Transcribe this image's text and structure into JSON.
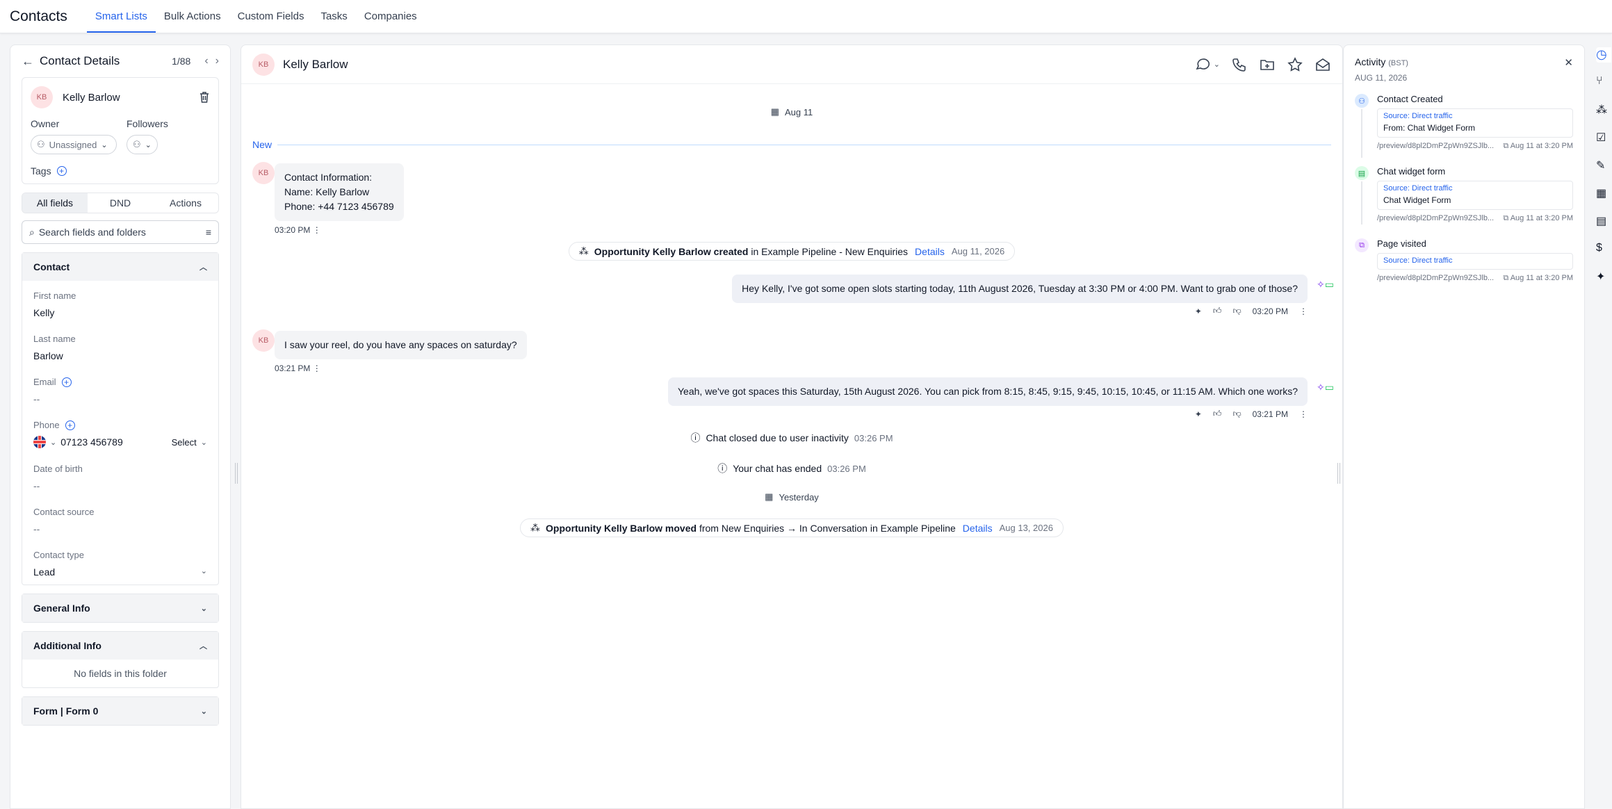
{
  "topnav": {
    "title": "Contacts",
    "tabs": [
      "Smart Lists",
      "Bulk Actions",
      "Custom Fields",
      "Tasks",
      "Companies"
    ],
    "active_tab": "Smart Lists"
  },
  "left": {
    "title": "Contact Details",
    "counter": "1/88",
    "contact_initials": "KB",
    "contact_name": "Kelly Barlow",
    "owner_label": "Owner",
    "owner_value": "Unassigned",
    "followers_label": "Followers",
    "tags_label": "Tags",
    "tabs": [
      "All fields",
      "DND",
      "Actions"
    ],
    "search_placeholder": "Search fields and folders",
    "contact_section": "Contact",
    "fields": {
      "first_name_label": "First name",
      "first_name": "Kelly",
      "last_name_label": "Last name",
      "last_name": "Barlow",
      "email_label": "Email",
      "email": "--",
      "phone_label": "Phone",
      "phone": "07123 456789",
      "phone_type": "Select",
      "dob_label": "Date of birth",
      "dob": "--",
      "source_label": "Contact source",
      "source": "--",
      "type_label": "Contact type",
      "type": "Lead"
    },
    "general_info": "General Info",
    "additional_info": "Additional Info",
    "no_fields": "No fields in this folder",
    "form_section": "Form | Form 0"
  },
  "center": {
    "initials": "KB",
    "name": "Kelly Barlow",
    "date_chip_1": "Aug 11",
    "new_label": "New",
    "msg1": {
      "line1": "Contact Information:",
      "line2": "Name: Kelly Barlow",
      "line3": "Phone: +44 7123 456789",
      "time": "03:20 PM"
    },
    "event1": {
      "prefix": "Opportunity Kelly Barlow created",
      "rest": "in Example Pipeline - New Enquiries",
      "details": "Details",
      "date": "Aug 11, 2026"
    },
    "msg2": {
      "text": "Hey Kelly, I've got some open slots starting today, 11th August 2026, Tuesday at 3:30 PM or 4:00 PM. Want to grab one of those?",
      "time": "03:20 PM"
    },
    "msg3": {
      "text": "I saw your reel, do you have any spaces on saturday?",
      "time": "03:21 PM"
    },
    "msg4": {
      "text": "Yeah, we've got spaces this Saturday, 15th August 2026. You can pick from 8:15, 8:45, 9:15, 9:45, 10:15, 10:45, or 11:15 AM. Which one works?",
      "time": "03:21 PM"
    },
    "sys1": {
      "text": "Chat closed due to user inactivity",
      "time": "03:26 PM"
    },
    "sys2": {
      "text": "Your chat has ended",
      "time": "03:26 PM"
    },
    "date_chip_2": "Yesterday",
    "event2": {
      "prefix": "Opportunity Kelly Barlow moved",
      "rest": "from New Enquiries → In Conversation in Example Pipeline",
      "details": "Details",
      "date": "Aug 13, 2026"
    }
  },
  "activity": {
    "title": "Activity",
    "tz": "(BST)",
    "date": "AUG 11, 2026",
    "items": [
      {
        "title": "Contact Created",
        "source": "Source: Direct traffic",
        "form": "From: Chat Widget Form",
        "path": "/preview/d8pl2DmPZpWn9ZSJlb...",
        "time": "Aug 11 at 3:20 PM"
      },
      {
        "title": "Chat widget form",
        "source": "Source: Direct traffic",
        "form": "Chat Widget Form",
        "path": "/preview/d8pl2DmPZpWn9ZSJlb...",
        "time": "Aug 11 at 3:20 PM"
      },
      {
        "title": "Page visited",
        "source": "Source: Direct traffic",
        "form": "",
        "path": "/preview/d8pl2DmPZpWn9ZSJlb...",
        "time": "Aug 11 at 3:20 PM"
      }
    ]
  },
  "colors": {
    "accent": "#2563eb",
    "avatar_bg": "#fde2e4",
    "green": "#22c55e"
  }
}
